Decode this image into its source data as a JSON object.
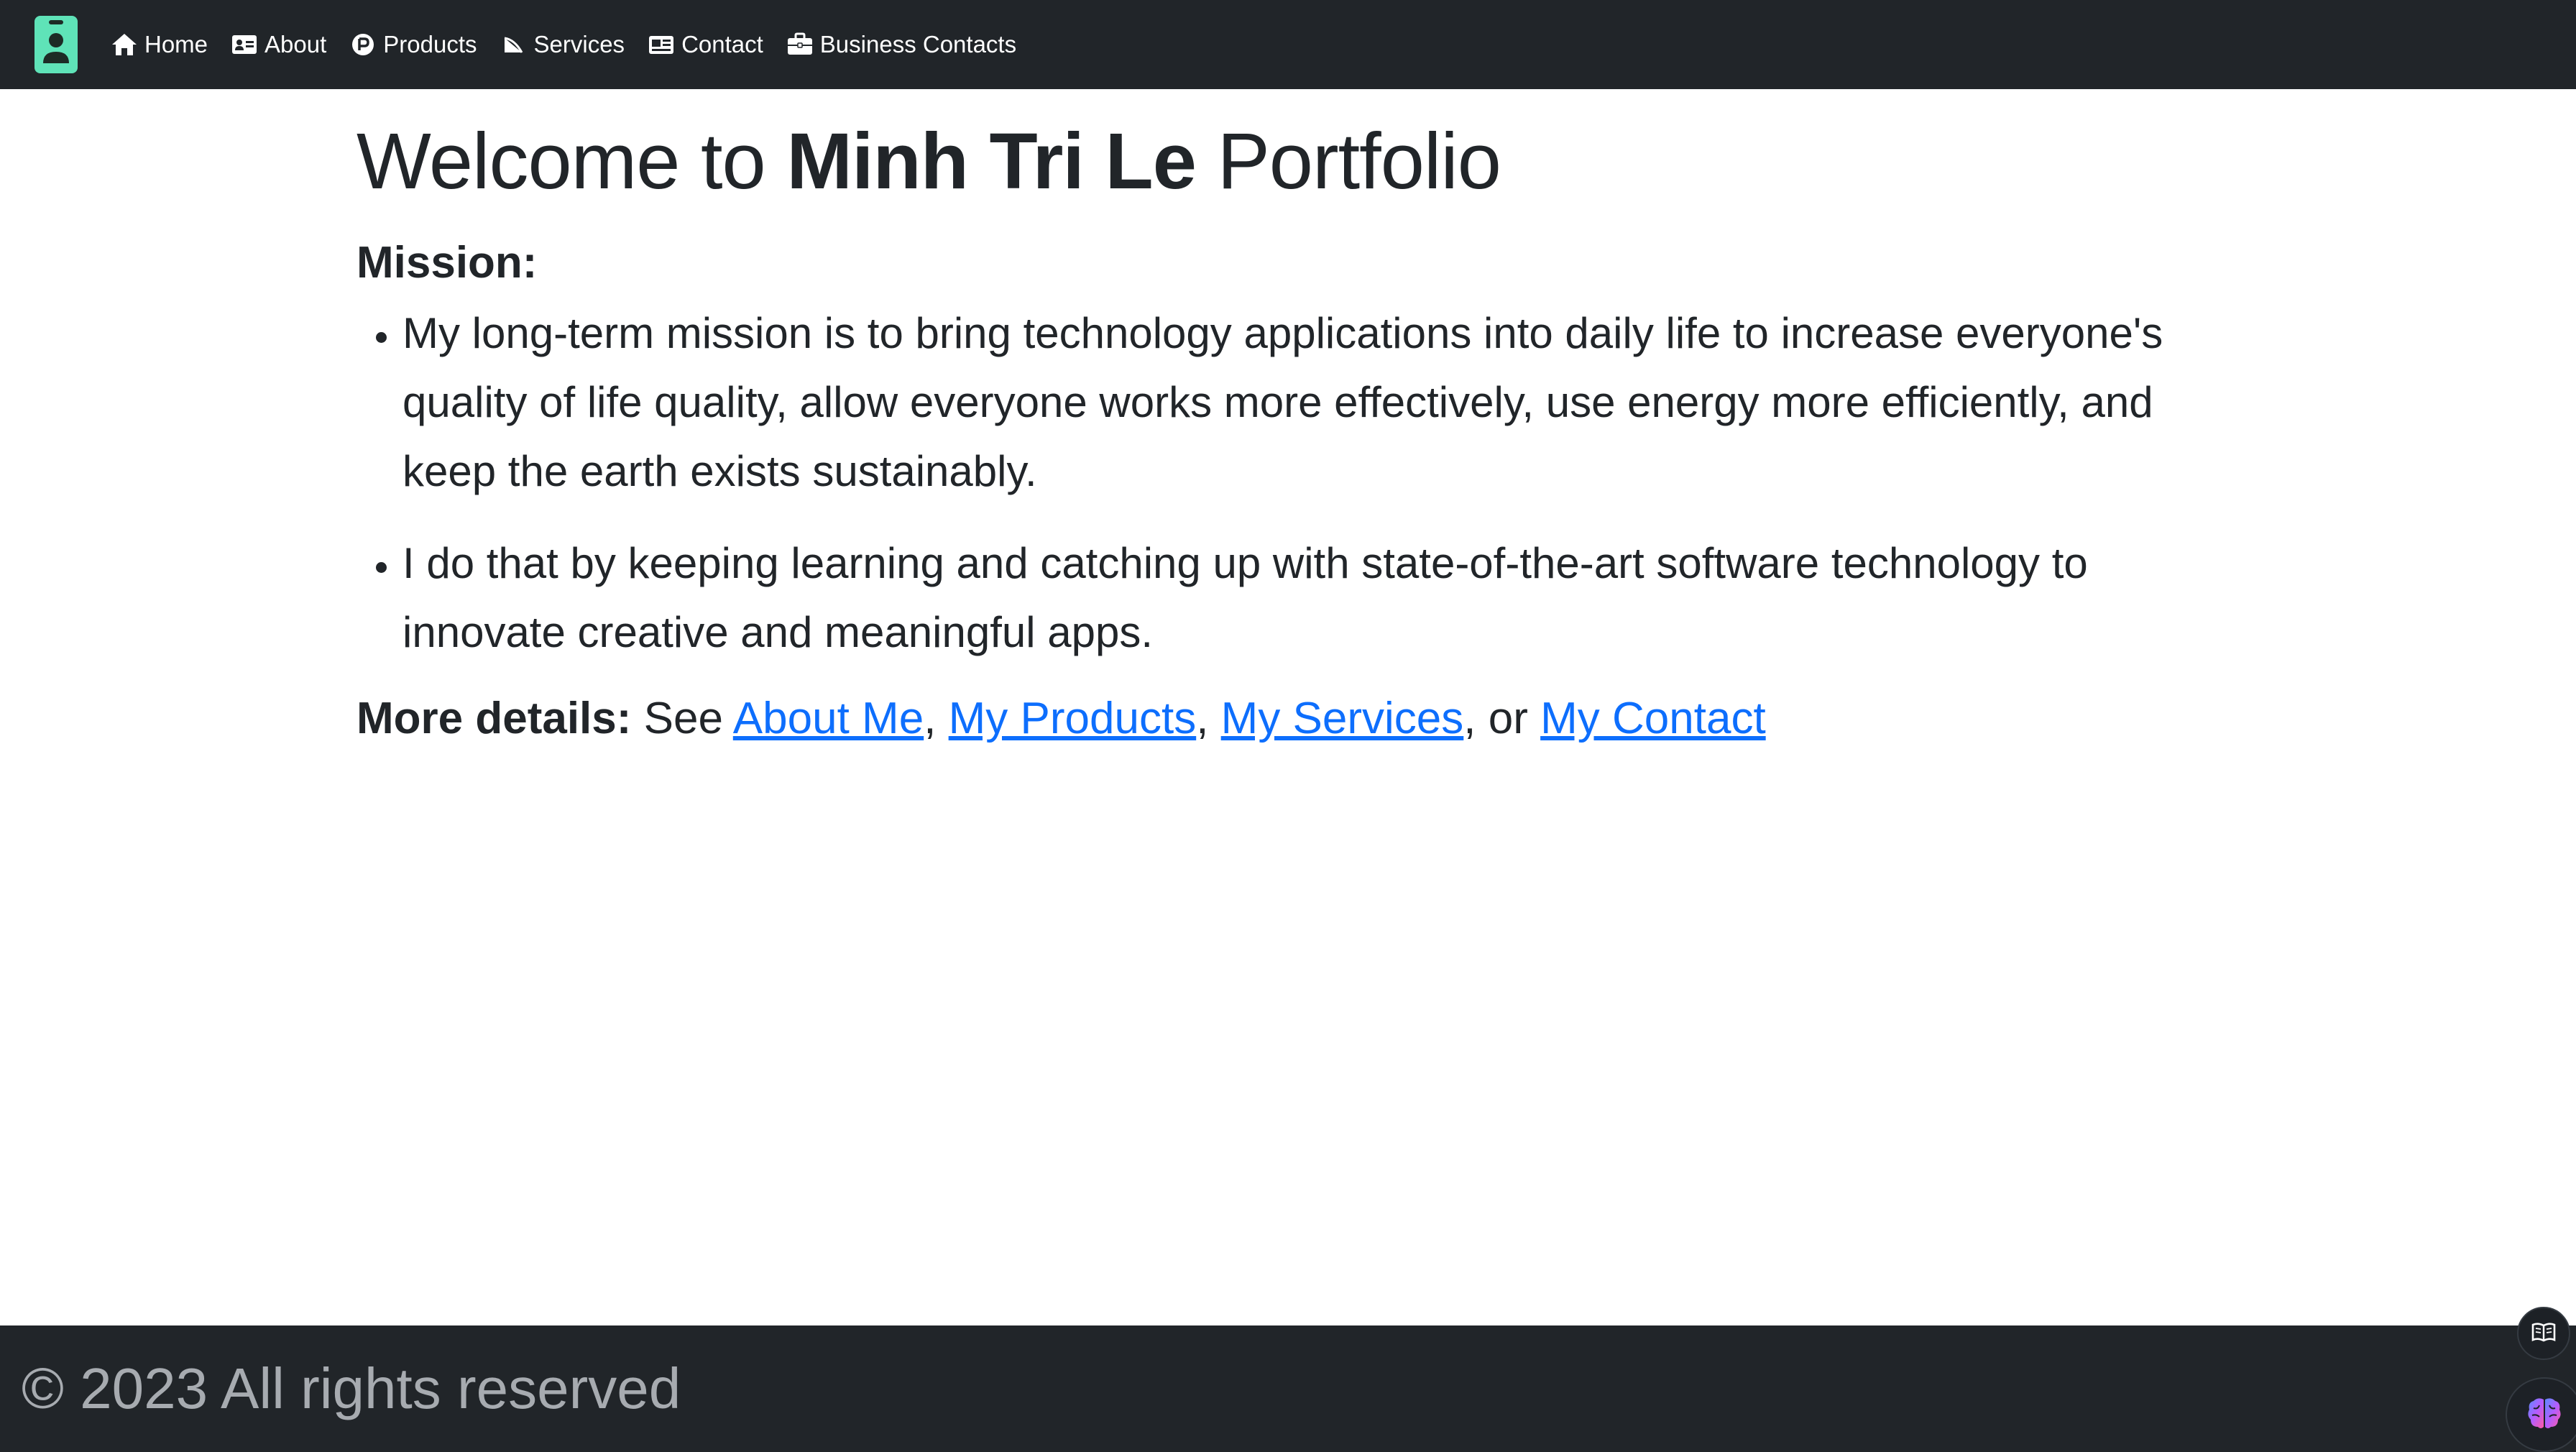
{
  "navbar": {
    "brand_icon": "id-badge-icon",
    "brand_color": "#5fe3b8",
    "background": "#212529",
    "items": [
      {
        "label": "Home",
        "icon": "home-icon"
      },
      {
        "label": "About",
        "icon": "id-card-icon"
      },
      {
        "label": "Products",
        "icon": "product-circle-icon"
      },
      {
        "label": "Services",
        "icon": "service-icon"
      },
      {
        "label": "Contact",
        "icon": "contact-card-icon"
      },
      {
        "label": "Business Contacts",
        "icon": "briefcase-icon"
      }
    ]
  },
  "main": {
    "title": {
      "prefix": "Welcome to",
      "name": "Minh Tri Le",
      "suffix": "Portfolio"
    },
    "mission_heading": "Mission:",
    "mission_items": [
      "My long-term mission is to bring technology applications into daily life to increase everyone's quality of life quality, allow everyone works more effectively, use energy more efficiently, and keep the earth exists sustainably.",
      "I do that by keeping learning and catching up with state-of-the-art software technology to innovate creative and meaningful apps."
    ],
    "details": {
      "label": "More details:",
      "see": "See",
      "links": [
        "About Me",
        "My Products",
        "My Services",
        "My Contact"
      ],
      "sep": ",",
      "or": "or"
    },
    "link_color": "#0d6efd"
  },
  "footer": {
    "text": "© 2023 All rights reserved"
  },
  "floating": {
    "reader_icon": "book-open-icon",
    "ai_icon": "brain-icon"
  }
}
